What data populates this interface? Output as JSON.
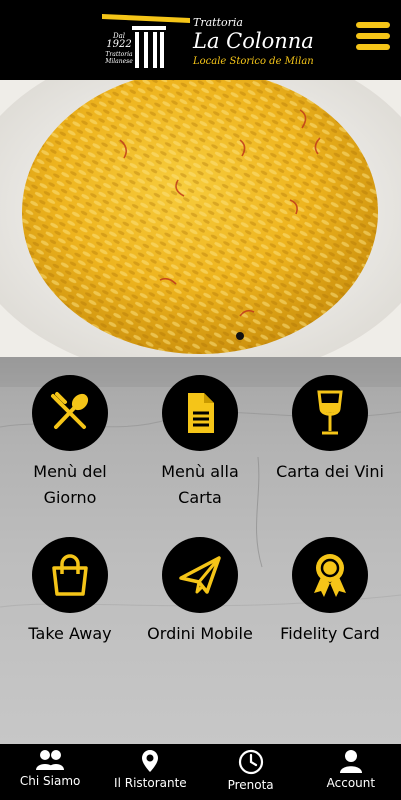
{
  "header": {
    "logo_line1": "Trattoria",
    "logo_line2": "La Colonna",
    "logo_line3": "Locale Storico de Milan",
    "est_dal": "Dal",
    "est_year": "1922",
    "est_trattoria": "Trattoria",
    "est_milanese": "Milanese",
    "menu_icon": "hamburger-icon"
  },
  "hero": {
    "image": "saffron-risotto",
    "slide_count": 1,
    "active_slide": 1
  },
  "tiles": [
    {
      "label_1": "Menù del",
      "label_2": "Giorno",
      "icon": "fork-spoon-icon"
    },
    {
      "label_1": "Menù alla",
      "label_2": "Carta",
      "icon": "document-icon"
    },
    {
      "label_1": "Carta dei Vini",
      "label_2": "",
      "icon": "wine-glass-icon"
    },
    {
      "label_1": "Take Away",
      "label_2": "",
      "icon": "shopping-bag-icon"
    },
    {
      "label_1": "Ordini Mobile",
      "label_2": "",
      "icon": "paper-plane-icon"
    },
    {
      "label_1": "Fidelity Card",
      "label_2": "",
      "icon": "award-ribbon-icon"
    }
  ],
  "bottom_nav": [
    {
      "label": "Chi Siamo",
      "icon": "people-icon"
    },
    {
      "label": "Il Ristorante",
      "icon": "location-pin-icon"
    },
    {
      "label": "Prenota",
      "icon": "clock-icon"
    },
    {
      "label": "Account",
      "icon": "user-icon"
    }
  ],
  "colors": {
    "accent": "#f5c518",
    "background": "#000000",
    "tile_circle": "#000000"
  }
}
